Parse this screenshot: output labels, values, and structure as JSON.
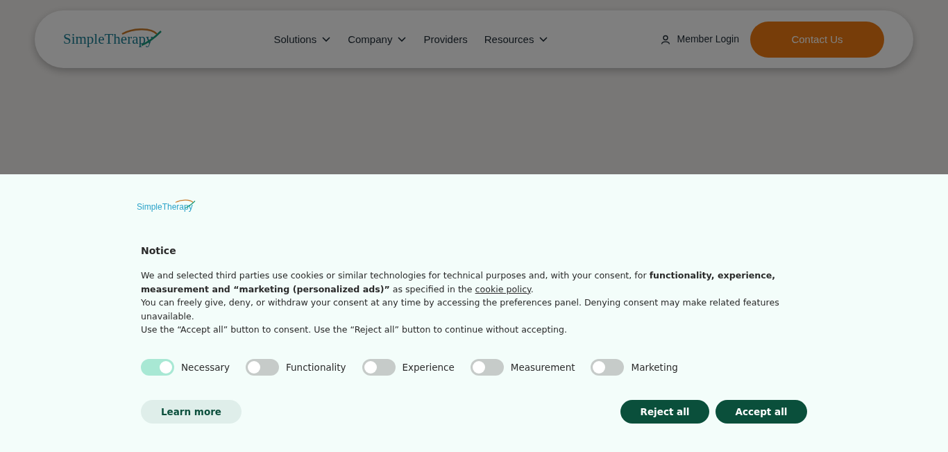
{
  "header": {
    "logo": "SimpleTherapy",
    "nav": [
      {
        "label": "Solutions",
        "dropdown": true
      },
      {
        "label": "Company",
        "dropdown": true
      },
      {
        "label": "Providers",
        "dropdown": false
      },
      {
        "label": "Resources",
        "dropdown": true
      }
    ],
    "member_login": "Member Login",
    "contact_button": "Contact Us"
  },
  "cookie_banner": {
    "logo": "SimpleTherapy",
    "title": "Notice",
    "paragraphs": [
      {
        "text": "We and selected third parties use cookies or similar technologies for technical purposes and, with your consent, for **functionality, experience, measurement and “marketing (personalized ads)”** as specified in the ",
        "link": "cookie policy",
        "text_after": "."
      },
      {
        "text": "You can freely give, deny, or withdraw your consent at any time by accessing the preferences panel. Denying consent may make related features unavailable."
      },
      {
        "text": "Use the “Accept all” button to consent. Use the “Reject all” button to continue without accepting."
      }
    ],
    "toggles": [
      {
        "label": "Necessary",
        "on": true
      },
      {
        "label": "Functionality",
        "on": false
      },
      {
        "label": "Experience",
        "on": false
      },
      {
        "label": "Measurement",
        "on": false
      },
      {
        "label": "Marketing",
        "on": false
      }
    ],
    "buttons": [
      {
        "label": "Learn more",
        "kind": "secondary"
      },
      {
        "label": "Reject all",
        "kind": "primary"
      },
      {
        "label": "Accept all",
        "kind": "primary"
      }
    ]
  }
}
